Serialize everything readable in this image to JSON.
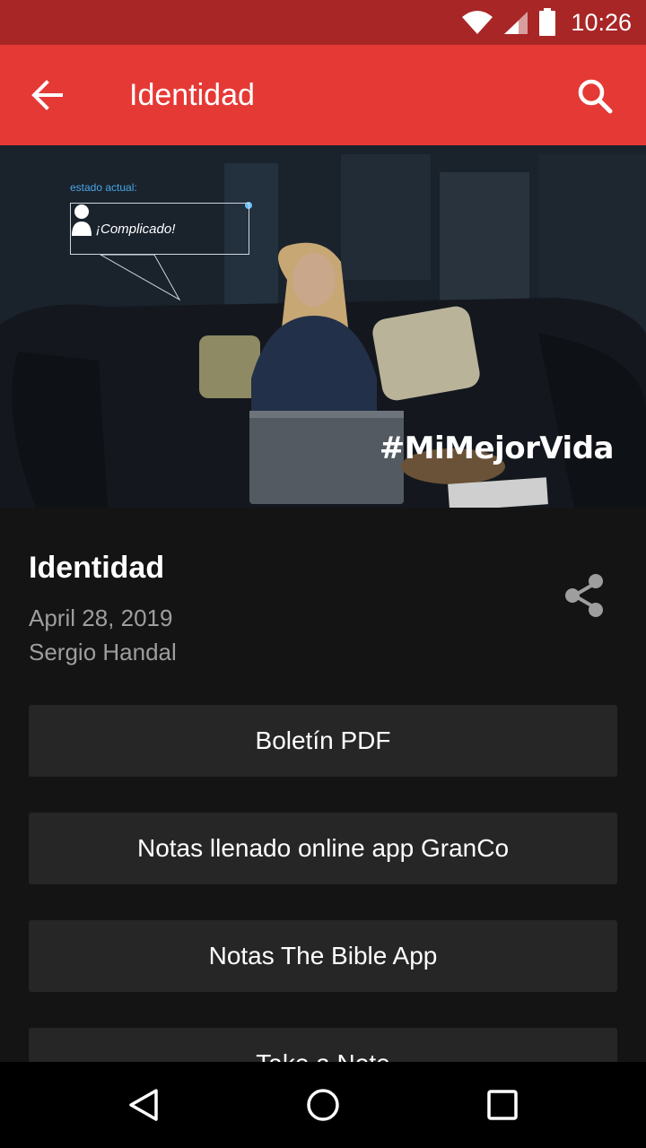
{
  "status_bar": {
    "time": "10:26"
  },
  "app_bar": {
    "title": "Identidad"
  },
  "hero": {
    "status_caption": "estado actual:",
    "bubble_text": "¡Complicado!",
    "hashtag": "#MiMejorVida"
  },
  "sermon": {
    "title": "Identidad",
    "date": "April 28, 2019",
    "author": "Sergio Handal"
  },
  "buttons": [
    {
      "label": "Boletín PDF"
    },
    {
      "label": "Notas llenado online app GranCo"
    },
    {
      "label": "Notas The Bible App"
    },
    {
      "label": "Take a Note"
    }
  ],
  "colors": {
    "status_bar": "#a82626",
    "app_bar": "#e53935",
    "background": "#141414",
    "button": "#262626",
    "secondary_text": "#9e9e9e"
  },
  "icons": [
    "wifi-icon",
    "signal-icon",
    "battery-icon",
    "back-arrow-icon",
    "search-icon",
    "share-icon",
    "nav-back-icon",
    "nav-home-icon",
    "nav-recents-icon"
  ]
}
